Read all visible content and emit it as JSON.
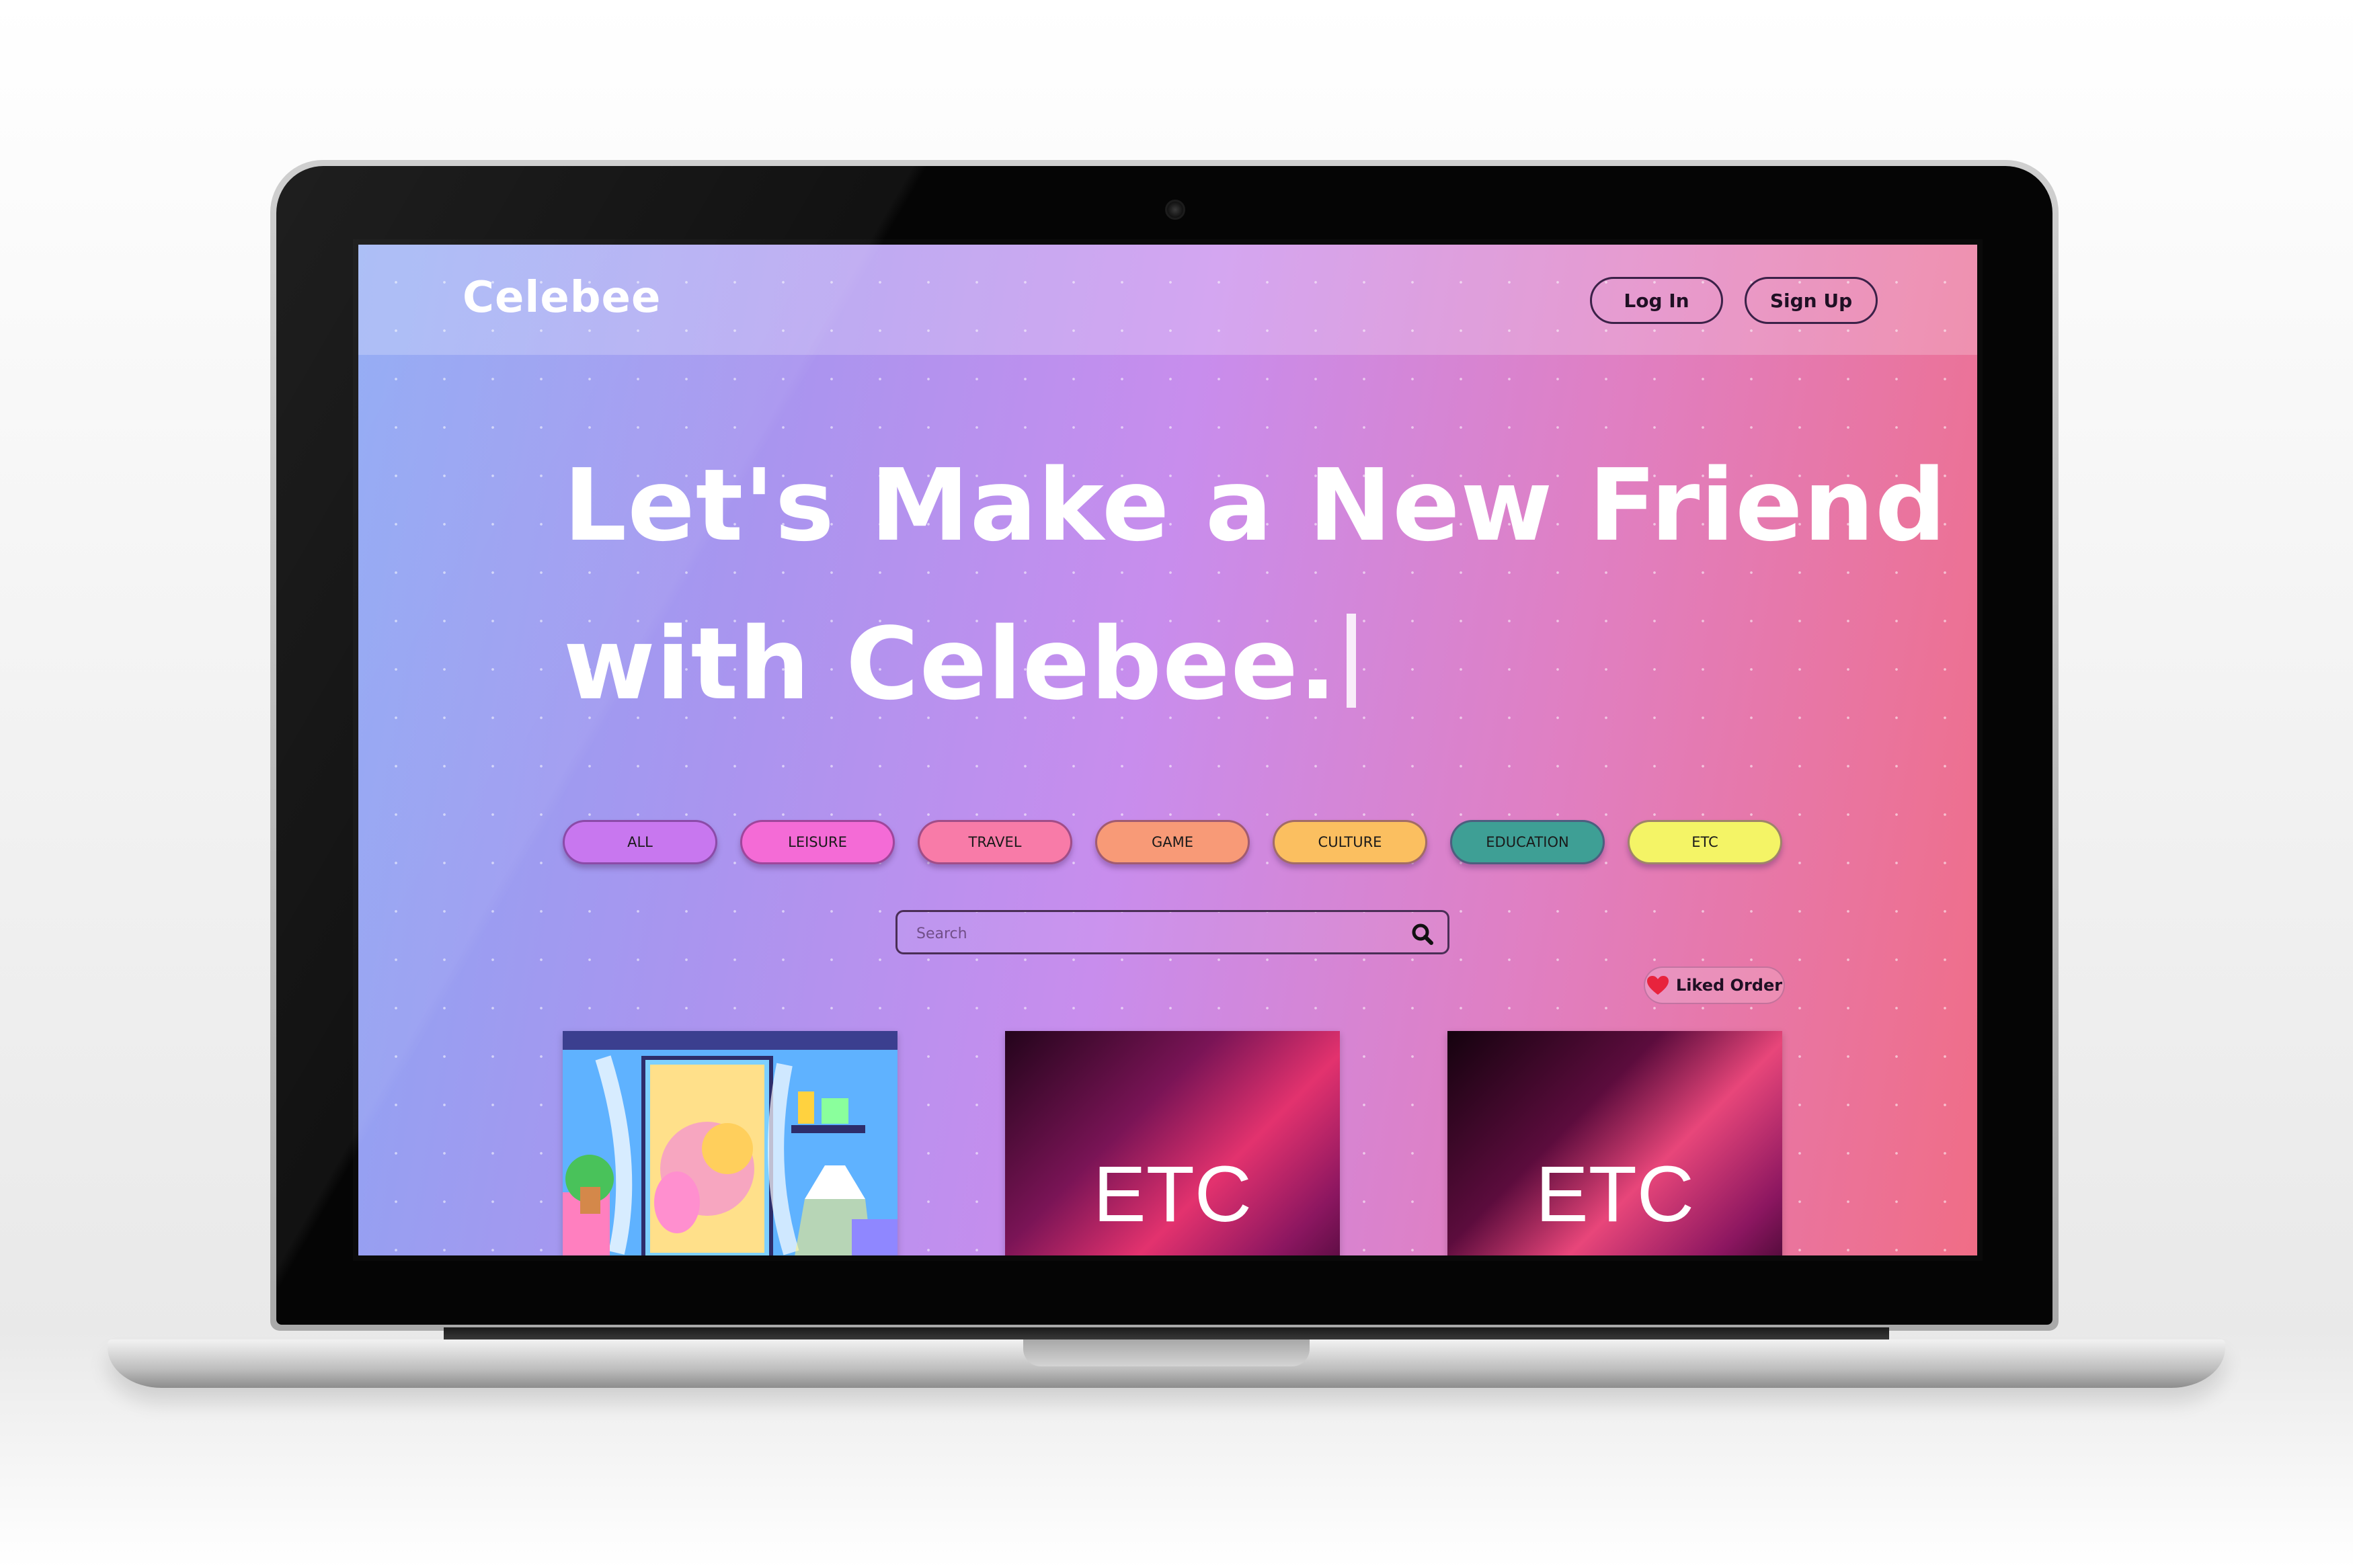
{
  "site": {
    "logo": "Celebee",
    "nav": {
      "login_label": "Log In",
      "signup_label": "Sign Up"
    },
    "hero": {
      "line1": "Let's Make a New Friend",
      "line2": "with Celebee."
    },
    "categories": [
      {
        "label": "ALL",
        "color": "#c877ef"
      },
      {
        "label": "LEISURE",
        "color": "#f46bd6"
      },
      {
        "label": "TRAVEL",
        "color": "#f87ba8"
      },
      {
        "label": "GAME",
        "color": "#f89a77"
      },
      {
        "label": "CULTURE",
        "color": "#fbbf60"
      },
      {
        "label": "EDUCATION",
        "color": "#3e9f95"
      },
      {
        "label": "ETC",
        "color": "#f4f466"
      }
    ],
    "search": {
      "placeholder": "Search"
    },
    "sort": {
      "label": "Liked Order",
      "icon": "heart-icon"
    },
    "cards": [
      {
        "type": "illustration",
        "label": ""
      },
      {
        "type": "gradient",
        "label": "ETC"
      },
      {
        "type": "gradient",
        "label": "ETC"
      }
    ]
  },
  "colors": {
    "gradient_start": "#8ba6f3",
    "gradient_mid": "#c88ded",
    "gradient_end": "#f06d86",
    "heart": "#e8233d"
  }
}
